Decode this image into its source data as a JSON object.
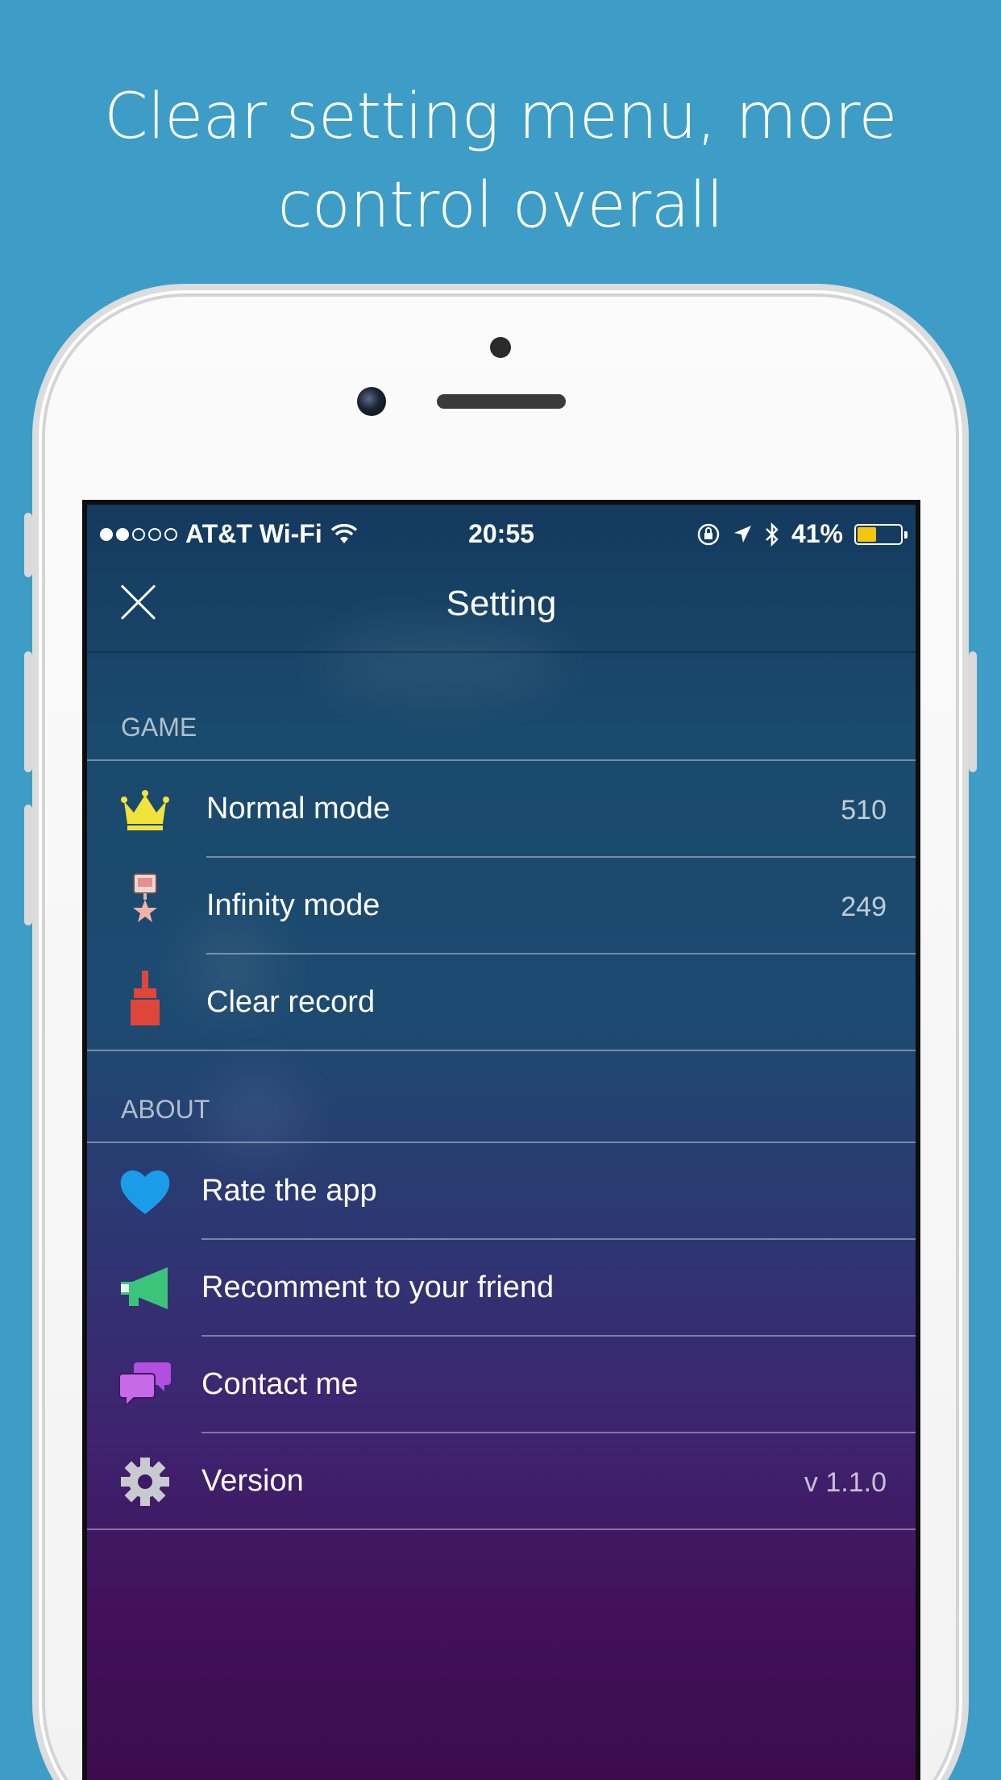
{
  "headline": "Clear setting menu, more control overall",
  "status_bar": {
    "carrier": "AT&T Wi-Fi",
    "time": "20:55",
    "battery": "41%",
    "battery_level": 0.41,
    "signal_bars_filled": 2,
    "signal_bars_total": 5
  },
  "nav": {
    "title": "Setting",
    "close_icon": "close-icon"
  },
  "sections": {
    "game": {
      "header": "GAME",
      "rows": [
        {
          "label": "Normal mode",
          "value": "510",
          "icon": "crown-icon"
        },
        {
          "label": "Infinity mode",
          "value": "249",
          "icon": "medal-icon"
        },
        {
          "label": "Clear record",
          "value": "",
          "icon": "brush-icon"
        }
      ]
    },
    "about": {
      "header": "ABOUT",
      "rows": [
        {
          "label": "Rate the app",
          "value": "",
          "icon": "heart-icon"
        },
        {
          "label": "Recomment to your friend",
          "value": "",
          "icon": "megaphone-icon"
        },
        {
          "label": "Contact me",
          "value": "",
          "icon": "chat-bubbles-icon"
        },
        {
          "label": "Version",
          "value": "v 1.1.0",
          "icon": "gear-icon"
        }
      ]
    }
  },
  "colors": {
    "page_background": "#3d9dc6",
    "crown": "#f2e33a",
    "heart": "#1a9ce8",
    "megaphone": "#3cc47a",
    "chat": "#b14fe0",
    "brush": "#e0453a",
    "gear": "#c9c9d0",
    "battery_fill": "#f4c60e"
  }
}
